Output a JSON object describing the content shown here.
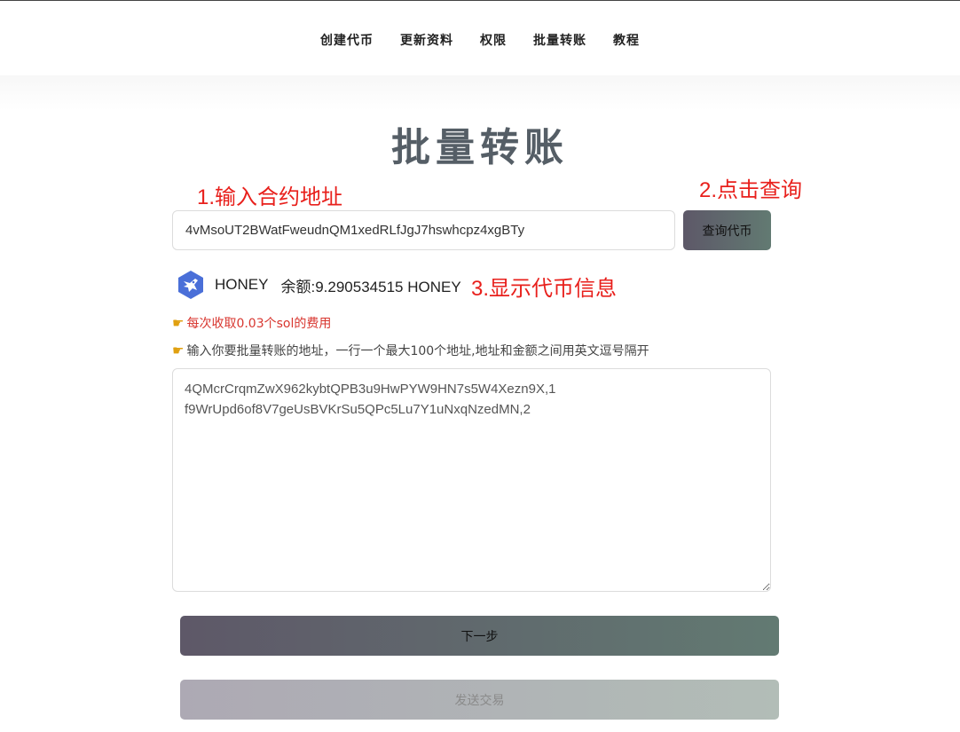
{
  "nav": {
    "items": [
      "创建代币",
      "更新资料",
      "权限",
      "批量转账",
      "教程"
    ]
  },
  "page": {
    "title": "批量转账"
  },
  "annotations": {
    "step1": "1.输入合约地址",
    "step2": "2.点击查询",
    "step3": "3.显示代币信息"
  },
  "contract": {
    "address": "4vMsoUT2BWatFweudnQM1xedRLfJgJ7hswhcpz4xgBTy",
    "query_label": "查询代币"
  },
  "token": {
    "logo_icon": "honey-token-icon",
    "name": "HONEY",
    "balance_label": "余额:",
    "balance_value": "9.290534515",
    "balance_symbol": "HONEY"
  },
  "tips": {
    "fee": "每次收取0.03个sol的费用",
    "instruction": "输入你要批量转账的地址，一行一个最大100个地址,地址和金额之间用英文逗号隔开",
    "hand_icon": "pointing-hand-icon"
  },
  "bulk_input": {
    "value": "4QMcrCrqmZwX962kybtQPB3u9HwPYW9HN7s5W4Xezn9X,1\nf9WrUpd6of8V7geUsBVKrSu5QPc5Lu7Y1uNxqNzedMN,2"
  },
  "buttons": {
    "next": "下一步",
    "send": "发送交易"
  },
  "colors": {
    "accent_start": "#5d5868",
    "accent_end": "#627a72",
    "annotation_red": "#e8201c",
    "fee_red": "#d8362f",
    "token_logo_blue": "#4a6fd8"
  }
}
